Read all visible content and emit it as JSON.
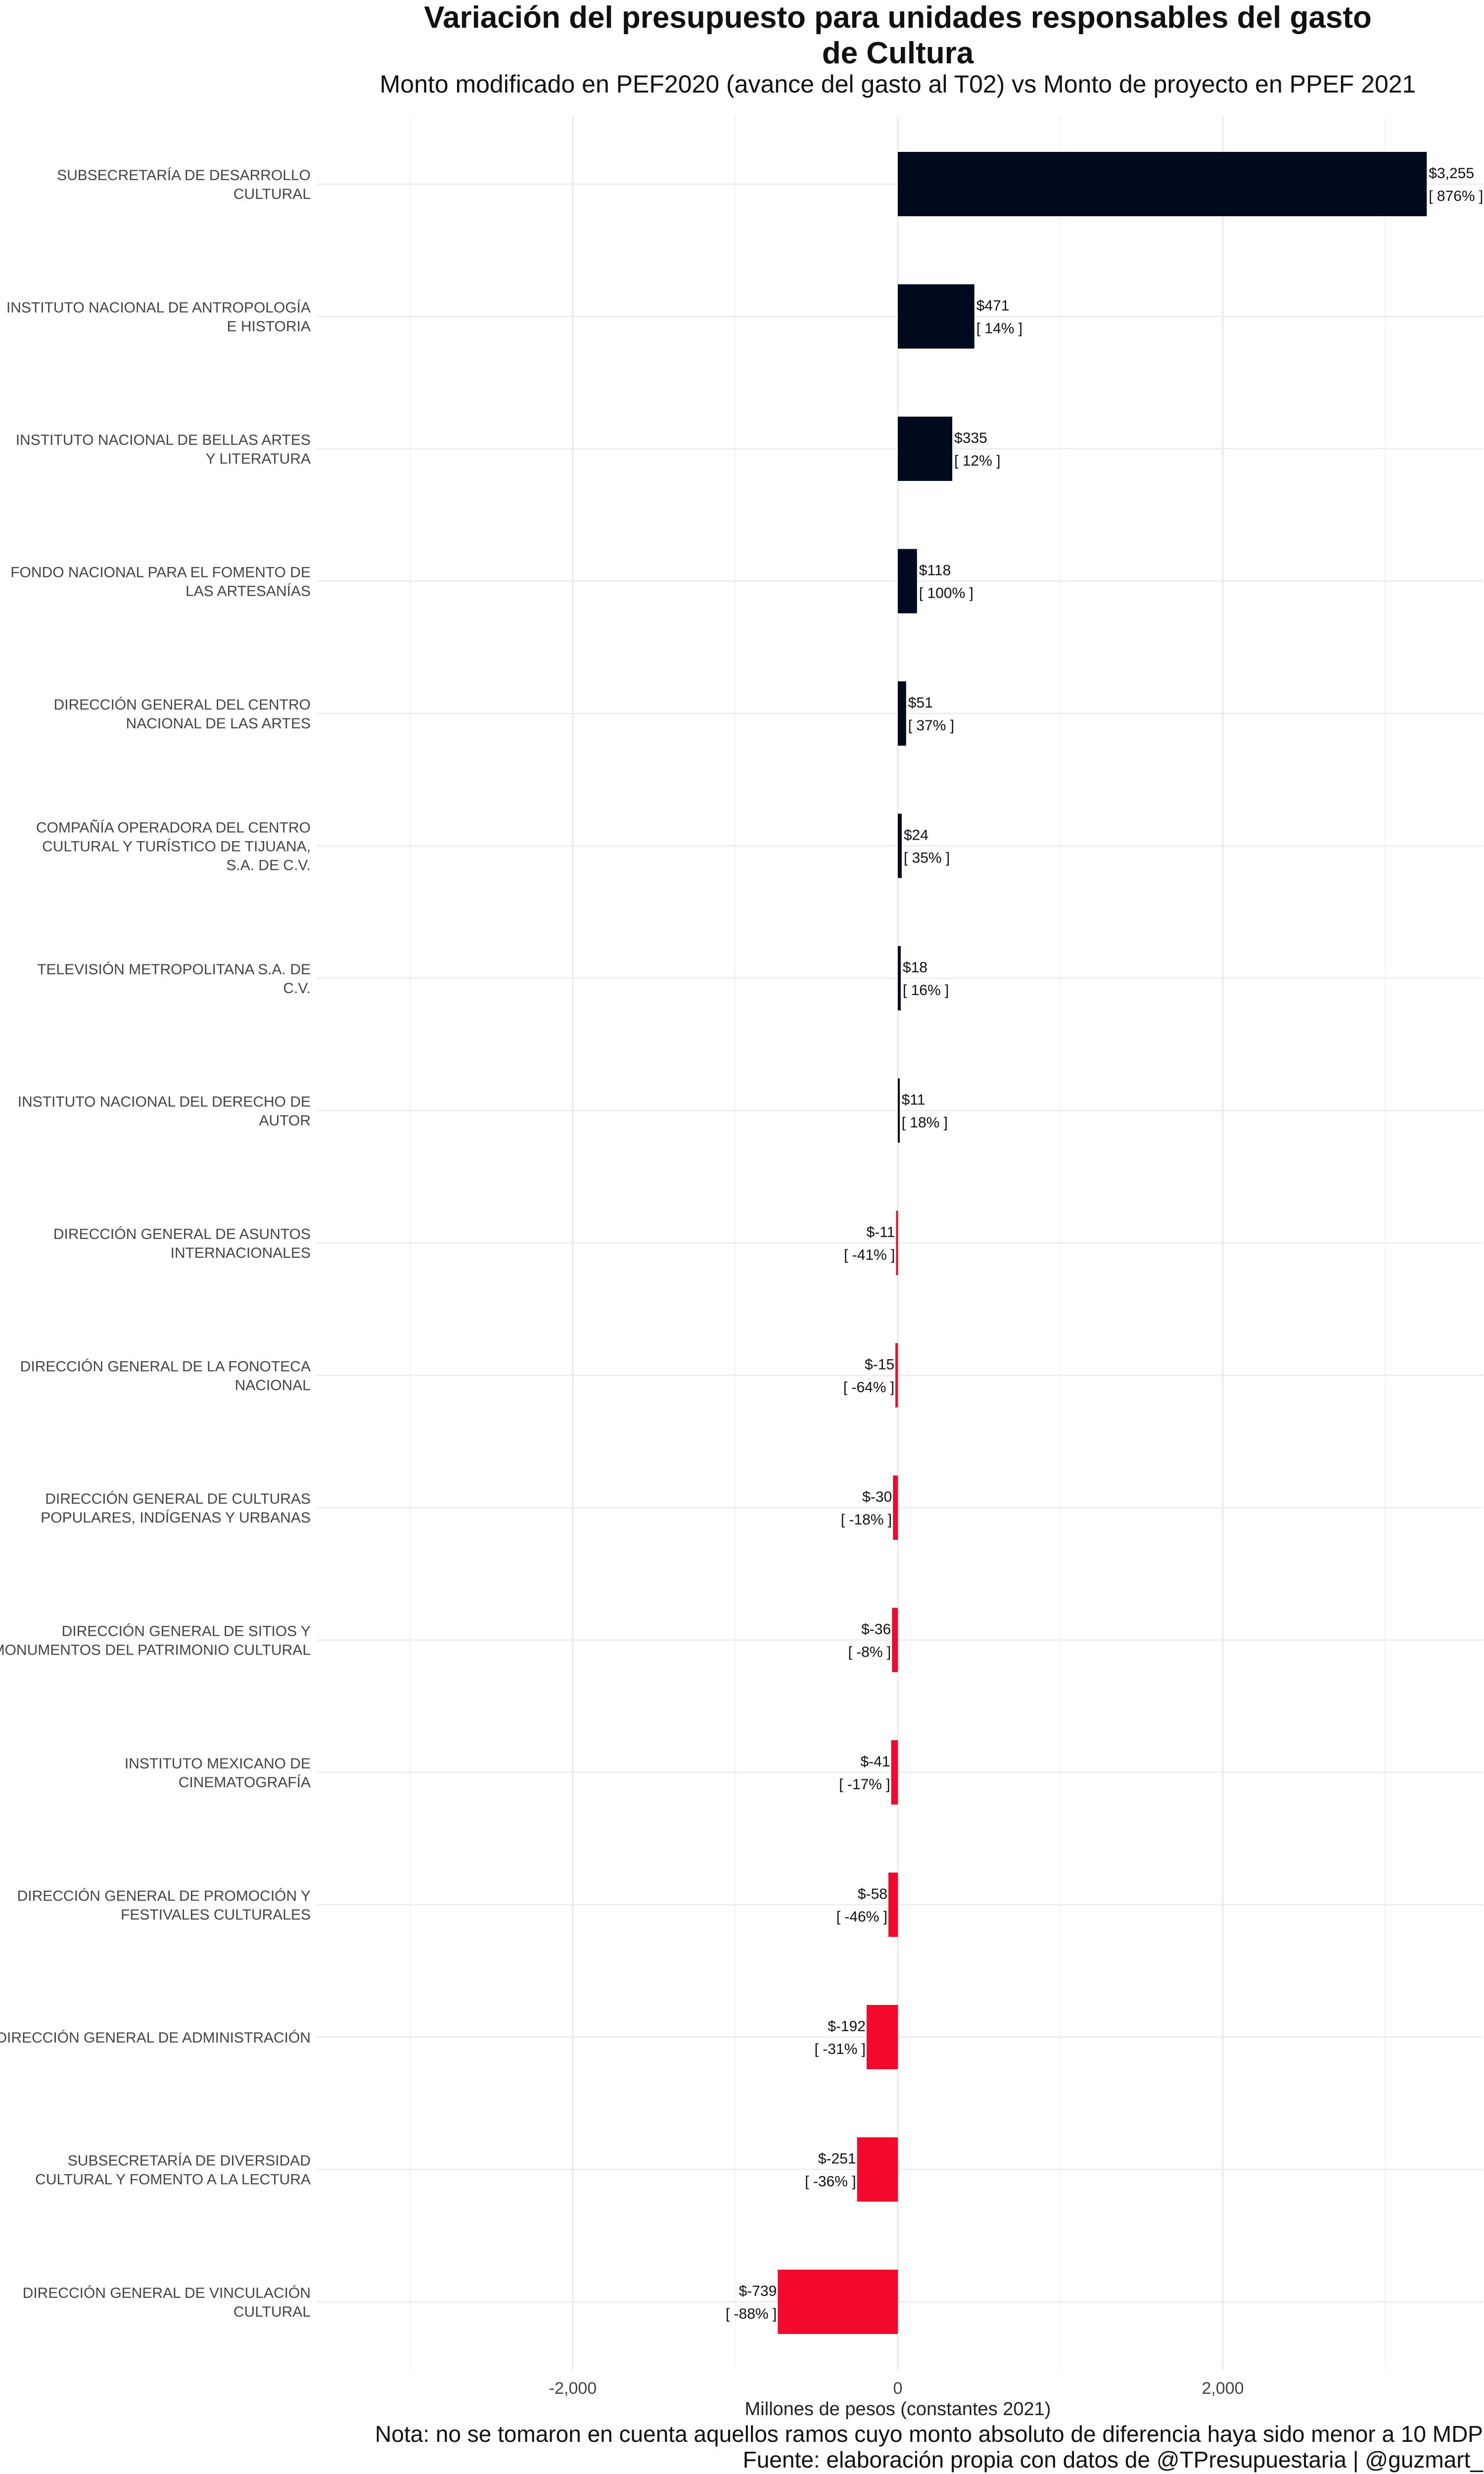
{
  "chart_data": {
    "type": "bar",
    "orientation": "horizontal",
    "title": "Variación del presupuesto para unidades responsables del gasto de Cultura",
    "subtitle": "Monto modificado en PEF2020 (avance del gasto al T02) vs Monto de proyecto en PPEF 2021",
    "xlabel": "Millones de pesos (constantes 2021)",
    "xlim": [
      -3500,
      3600
    ],
    "xticks": [
      -2000,
      0,
      2000
    ],
    "xtick_labels": [
      "-2,000",
      "0",
      "2,000"
    ],
    "grid": true,
    "colors": {
      "positive": "#020a1f",
      "negative": "#f2092b"
    },
    "bars": [
      {
        "category": "SUBSECRETARÍA DE DESARROLLO\nCULTURAL",
        "value": 3255,
        "value_label": "$3,255",
        "pct_label": "[ 876% ]"
      },
      {
        "category": "INSTITUTO NACIONAL DE ANTROPOLOGÍA\nE HISTORIA",
        "value": 471,
        "value_label": "$471",
        "pct_label": "[ 14% ]"
      },
      {
        "category": "INSTITUTO NACIONAL DE BELLAS ARTES\nY LITERATURA",
        "value": 335,
        "value_label": "$335",
        "pct_label": "[ 12% ]"
      },
      {
        "category": "FONDO NACIONAL PARA EL FOMENTO DE\nLAS ARTESANÍAS",
        "value": 118,
        "value_label": "$118",
        "pct_label": "[ 100% ]"
      },
      {
        "category": "DIRECCIÓN GENERAL DEL CENTRO\nNACIONAL DE LAS ARTES",
        "value": 51,
        "value_label": "$51",
        "pct_label": "[ 37% ]"
      },
      {
        "category": "COMPAÑÍA OPERADORA DEL CENTRO\nCULTURAL Y TURÍSTICO DE TIJUANA,\nS.A. DE C.V.",
        "value": 24,
        "value_label": "$24",
        "pct_label": "[ 35% ]"
      },
      {
        "category": "TELEVISIÓN METROPOLITANA S.A. DE\nC.V.",
        "value": 18,
        "value_label": "$18",
        "pct_label": "[ 16% ]"
      },
      {
        "category": "INSTITUTO NACIONAL DEL DERECHO DE\nAUTOR",
        "value": 11,
        "value_label": "$11",
        "pct_label": "[ 18% ]"
      },
      {
        "category": "DIRECCIÓN GENERAL DE ASUNTOS\nINTERNACIONALES",
        "value": -11,
        "value_label": "$-11",
        "pct_label": "[ -41% ]"
      },
      {
        "category": "DIRECCIÓN GENERAL DE LA FONOTECA\nNACIONAL",
        "value": -15,
        "value_label": "$-15",
        "pct_label": "[ -64% ]"
      },
      {
        "category": "DIRECCIÓN GENERAL DE CULTURAS\nPOPULARES, INDÍGENAS Y URBANAS",
        "value": -30,
        "value_label": "$-30",
        "pct_label": "[ -18% ]"
      },
      {
        "category": "DIRECCIÓN GENERAL DE SITIOS Y\nMONUMENTOS DEL PATRIMONIO CULTURAL",
        "value": -36,
        "value_label": "$-36",
        "pct_label": "[ -8% ]"
      },
      {
        "category": "INSTITUTO MEXICANO DE\nCINEMATOGRAFÍA",
        "value": -41,
        "value_label": "$-41",
        "pct_label": "[ -17% ]"
      },
      {
        "category": "DIRECCIÓN GENERAL DE PROMOCIÓN Y\nFESTIVALES CULTURALES",
        "value": -58,
        "value_label": "$-58",
        "pct_label": "[ -46% ]"
      },
      {
        "category": "DIRECCIÓN GENERAL DE ADMINISTRACIÓN",
        "value": -192,
        "value_label": "$-192",
        "pct_label": "[ -31% ]"
      },
      {
        "category": "SUBSECRETARÍA DE DIVERSIDAD\nCULTURAL Y FOMENTO A LA LECTURA",
        "value": -251,
        "value_label": "$-251",
        "pct_label": "[ -36% ]"
      },
      {
        "category": "DIRECCIÓN GENERAL DE VINCULACIÓN\nCULTURAL",
        "value": -739,
        "value_label": "$-739",
        "pct_label": "[ -88% ]"
      }
    ]
  },
  "footer": {
    "note": "Nota: no se tomaron en cuenta aquellos ramos cuyo monto absoluto de diferencia haya sido menor a 10 MDP",
    "source": "Fuente: elaboración propia con datos de @TPresupuestaria | @guzmart_"
  }
}
